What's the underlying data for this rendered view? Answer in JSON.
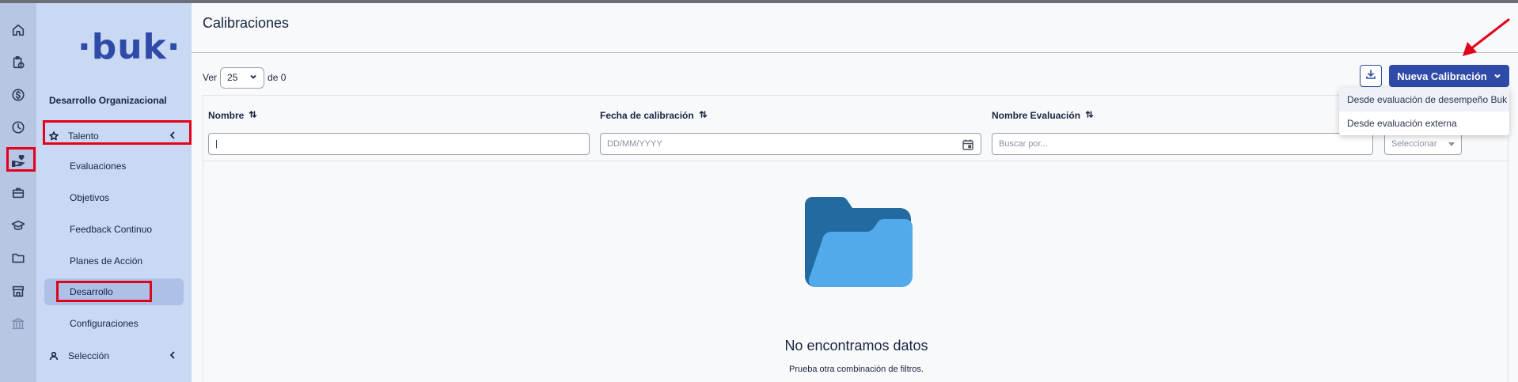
{
  "rail": {
    "icons": [
      "home-icon",
      "clipboard-clock-icon",
      "dollar-icon",
      "clock-icon",
      "hand-heart-icon",
      "briefcase-icon",
      "graduation-cap-icon",
      "folder-icon",
      "store-icon",
      "bank-icon"
    ]
  },
  "sidebar": {
    "logo": "·buk·",
    "section_title": "Desarrollo Organizacional",
    "talento_label": "Talento",
    "items": [
      {
        "label": "Evaluaciones"
      },
      {
        "label": "Objetivos"
      },
      {
        "label": "Feedback Continuo"
      },
      {
        "label": "Planes de Acción"
      },
      {
        "label": "Desarrollo"
      },
      {
        "label": "Configuraciones"
      }
    ],
    "seleccion_label": "Selección"
  },
  "main": {
    "title": "Calibraciones",
    "ver_label": "Ver",
    "page_size": "25",
    "de_label": "de 0",
    "new_button": "Nueva Calibración",
    "columns": [
      {
        "label": "Nombre"
      },
      {
        "label": "Fecha de calibración"
      },
      {
        "label": "Nombre Evaluación"
      }
    ],
    "filters": {
      "nombre_value": "|",
      "fecha_placeholder": "DD/MM/YYYY",
      "evaluacion_placeholder": "Buscar por...",
      "select_placeholder": "Seleccionar"
    },
    "empty_title": "No encontramos datos",
    "empty_subtitle": "Prueba otra combinación de filtros."
  },
  "dropdown": {
    "items": [
      {
        "label": "Desde evaluación de desempeño Buk"
      },
      {
        "label": "Desde evaluación externa"
      }
    ]
  },
  "colors": {
    "brand": "#2f4ba8",
    "sidebar_bg": "#c9d8f3",
    "rail_bg": "#b8c6e4",
    "highlight": "#e3001b",
    "folder_dark": "#226a9f",
    "folder_light": "#52aaeb"
  }
}
